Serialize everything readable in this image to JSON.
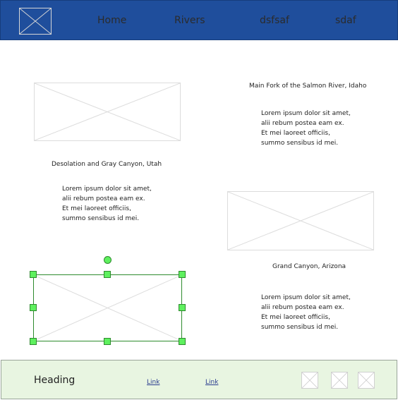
{
  "header": {
    "nav": [
      "Home",
      "Rivers",
      "dsfsaf",
      "sdaf"
    ],
    "background": "#1f4e9c"
  },
  "sections": [
    {
      "caption": "Main Fork of the Salmon River, Idaho",
      "text": "Lorem ipsum dolor sit amet, alii rebum postea eam ex. Et mei laoreet officiis, summo sensibus id mei."
    },
    {
      "caption": "Desolation and Gray Canyon, Utah",
      "text": "Lorem ipsum dolor sit amet, alii rebum postea eam ex. Et mei laoreet officiis, summo sensibus id mei."
    },
    {
      "caption": "Grand Canyon, Arizona",
      "text": "Lorem ipsum dolor sit amet, alii rebum postea eam ex. Et mei laoreet officiis, summo sensibus id mei."
    }
  ],
  "footer": {
    "heading": "Heading",
    "links": [
      "Link",
      "Link"
    ],
    "background": "#e8f5e1"
  },
  "icons": {
    "image_placeholder": "image-placeholder-icon",
    "selection_handle": "resize-handle-icon",
    "rotate_handle": "rotate-handle-icon"
  },
  "colors": {
    "selection": "#2e8b2e",
    "handle": "#5ef05e"
  }
}
